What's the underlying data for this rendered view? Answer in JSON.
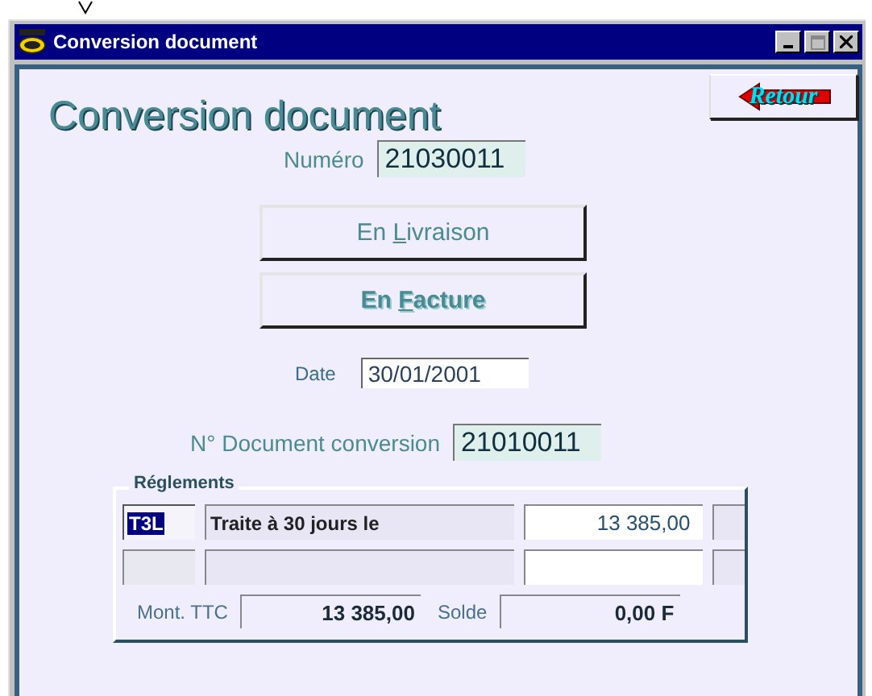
{
  "window": {
    "title": "Conversion document"
  },
  "header": {
    "title": "Conversion document",
    "back_button": "Retour"
  },
  "numero": {
    "label": "Numéro",
    "value": "21030011"
  },
  "actions": [
    {
      "label": "En Livraison",
      "default": false
    },
    {
      "label": "En Facture",
      "default": true
    }
  ],
  "date": {
    "label": "Date",
    "value": "30/01/2001"
  },
  "document_conversion": {
    "label": "N° Document conversion",
    "value": "21010011"
  },
  "reglements": {
    "title": "Réglements",
    "rows": [
      {
        "code": "T3L",
        "label": "Traite à 30 jours le",
        "amount": "13 385,00",
        "selected": true
      },
      {
        "code": "",
        "label": "",
        "amount": "",
        "selected": false
      }
    ],
    "total_label": "Mont. TTC",
    "total": "13 385,00",
    "balance_label": "Solde",
    "balance": "0,00 F"
  }
}
